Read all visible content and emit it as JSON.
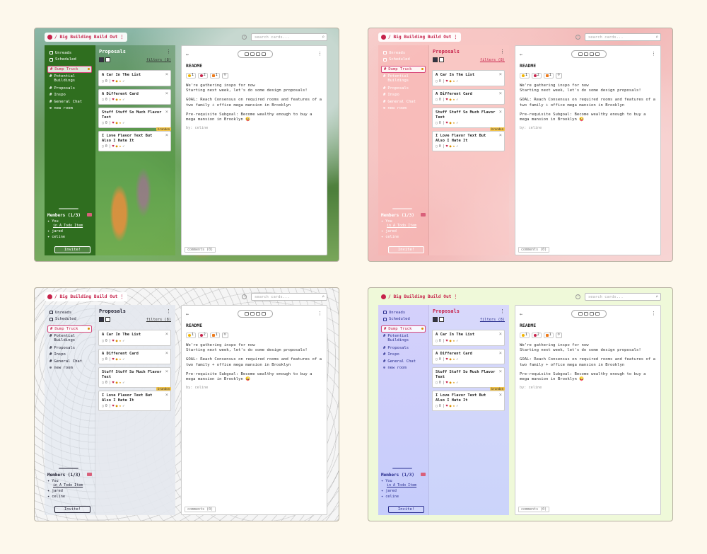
{
  "workspace_title": "/ Big Building Build Out",
  "search_placeholder": "search cards...",
  "nav_items": [
    {
      "label": "Unreads",
      "kind": "icon"
    },
    {
      "label": "Scheduled",
      "kind": "icon"
    },
    {
      "label": "Dump Truck",
      "kind": "active"
    },
    {
      "label": "Potential Buildings",
      "kind": "hash"
    },
    {
      "label": "Proposals",
      "kind": "hash"
    },
    {
      "label": "Inspo",
      "kind": "hash"
    },
    {
      "label": "General Chat",
      "kind": "hash"
    },
    {
      "label": "new room",
      "kind": "plus"
    }
  ],
  "members": {
    "title": "Members (1/3)",
    "rows": [
      {
        "name": "You",
        "sub": "in A Todo Item"
      },
      {
        "name": "jared",
        "sub": ""
      },
      {
        "name": "celine",
        "sub": ""
      }
    ],
    "invite": "Invite!"
  },
  "cards_panel": {
    "title": "Proposals",
    "filters": "filters (8)",
    "cards": [
      {
        "title": "A Car In The List",
        "meta": "0",
        "tag": ""
      },
      {
        "title": "A Different Card",
        "meta": "0",
        "tag": ""
      },
      {
        "title": "Stuff Stuff So Much Flavor Text",
        "meta": "0",
        "tag": "brandon"
      },
      {
        "title": "I Love Flavor Text But Also I Hate It",
        "meta": "0",
        "tag": ""
      }
    ]
  },
  "main": {
    "title": "README",
    "reactions": [
      "1",
      "2",
      "1"
    ],
    "paragraphs": [
      "We're gathering inspo for now\nStarting next week, let's do some design proposals!",
      "GOAL: Reach Consensus on required rooms and features of a two family + office mega mansion in Brooklyn",
      "Pre-requisite Subgoal: Become wealthy enough to buy a mega mansion in Brooklyn 😜"
    ],
    "author": "by: celine",
    "comments": "comments (0)"
  },
  "themes": [
    "forest",
    "pink",
    "cow",
    "lime"
  ],
  "colors": {
    "accent": "#c6224a",
    "page_bg": "#fdf8ec"
  }
}
